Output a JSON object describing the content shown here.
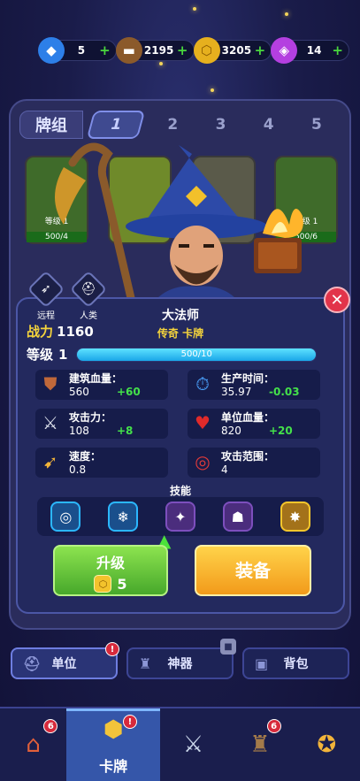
{
  "currencies": [
    {
      "name": "gems",
      "value": "5",
      "icon": "gem-icon",
      "color": "#4fa6ff"
    },
    {
      "name": "wood",
      "value": "2195",
      "icon": "wood-icon",
      "color": "#b07a3c"
    },
    {
      "name": "gold",
      "value": "3205",
      "icon": "gold-coin-icon",
      "color": "#f3c32c"
    },
    {
      "name": "crystal",
      "value": "14",
      "icon": "crystal-icon",
      "color": "#d85df5"
    }
  ],
  "deck": {
    "label": "牌组",
    "tabs": [
      "1",
      "2",
      "3",
      "4",
      "5"
    ],
    "active_tab": 0,
    "bg_cards": [
      {
        "level": "等级 1",
        "progress": "500/4"
      },
      {
        "level": "等级 1",
        "progress": "500/6"
      }
    ]
  },
  "unit": {
    "name": "大法师",
    "rarity": "传奇 卡牌",
    "power_label": "战力",
    "power_value": "1160",
    "level_label": "等级",
    "level_value": "1",
    "xp_text": "500/10",
    "xp_fraction": 1.0,
    "traits": [
      {
        "label": "远程",
        "icon": "bow-icon"
      },
      {
        "label": "人类",
        "icon": "helmet-icon"
      }
    ],
    "stats": [
      {
        "name": "建筑血量：",
        "value": "560",
        "delta": "+60",
        "icon": "shield-icon"
      },
      {
        "name": "生产时间：",
        "value": "35.97",
        "delta": "-0.03",
        "icon": "clock-icon"
      },
      {
        "name": "攻击力：",
        "value": "108",
        "delta": "+8",
        "icon": "sword-icon"
      },
      {
        "name": "单位血量：",
        "value": "820",
        "delta": "+20",
        "icon": "heart-icon"
      },
      {
        "name": "速度：",
        "value": "0.8",
        "delta": "",
        "icon": "wing-boot-icon"
      },
      {
        "name": "攻击范围：",
        "value": "4",
        "delta": "",
        "icon": "target-icon"
      }
    ],
    "skills_title": "技能",
    "skills": [
      {
        "icon": "target-skill-icon",
        "state": "unlocked"
      },
      {
        "icon": "frost-skill-icon",
        "state": "unlocked"
      },
      {
        "icon": "arcane-skill-icon",
        "state": "locked"
      },
      {
        "icon": "cloak-skill-icon",
        "state": "locked"
      },
      {
        "icon": "gold-skill-icon",
        "state": "gold"
      }
    ],
    "upgrade_label": "升级",
    "upgrade_cost": "5",
    "equip_label": "装备"
  },
  "sub_tabs": [
    {
      "label": "单位",
      "icon": "helmet-icon",
      "badge": "!"
    },
    {
      "label": "神器",
      "icon": "artifact-icon",
      "locked": true
    },
    {
      "label": "背包",
      "icon": "backpack-icon"
    }
  ],
  "bottom_nav": [
    {
      "label": "",
      "icon": "shop-icon",
      "badge": "6"
    },
    {
      "label": "卡牌",
      "icon": "cards-icon",
      "badge": "!",
      "active": true
    },
    {
      "label": "",
      "icon": "battle-swords-icon"
    },
    {
      "label": "",
      "icon": "tower-icon",
      "badge": "6"
    },
    {
      "label": "",
      "icon": "rank-crest-icon"
    }
  ]
}
